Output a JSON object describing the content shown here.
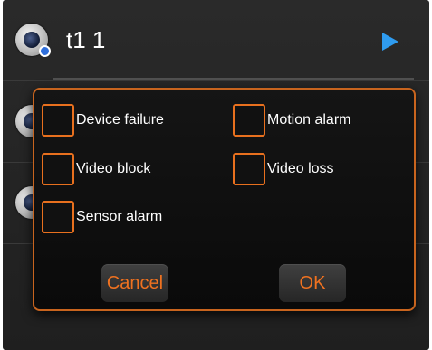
{
  "devices": [
    {
      "name": "t1 1"
    },
    {
      "name": ""
    },
    {
      "name": ""
    }
  ],
  "dialog": {
    "options": [
      {
        "label": "Device failure",
        "checked": false
      },
      {
        "label": "Motion alarm",
        "checked": false
      },
      {
        "label": "Video block",
        "checked": false
      },
      {
        "label": "Video loss",
        "checked": false
      },
      {
        "label": "Sensor alarm",
        "checked": false
      }
    ],
    "cancel_label": "Cancel",
    "ok_label": "OK"
  },
  "colors": {
    "accent": "#e8701e",
    "play_arrow": "#2f9cf0",
    "background": "#242424"
  },
  "icons": {
    "device": "camera-icon",
    "open": "play-arrow-icon"
  }
}
